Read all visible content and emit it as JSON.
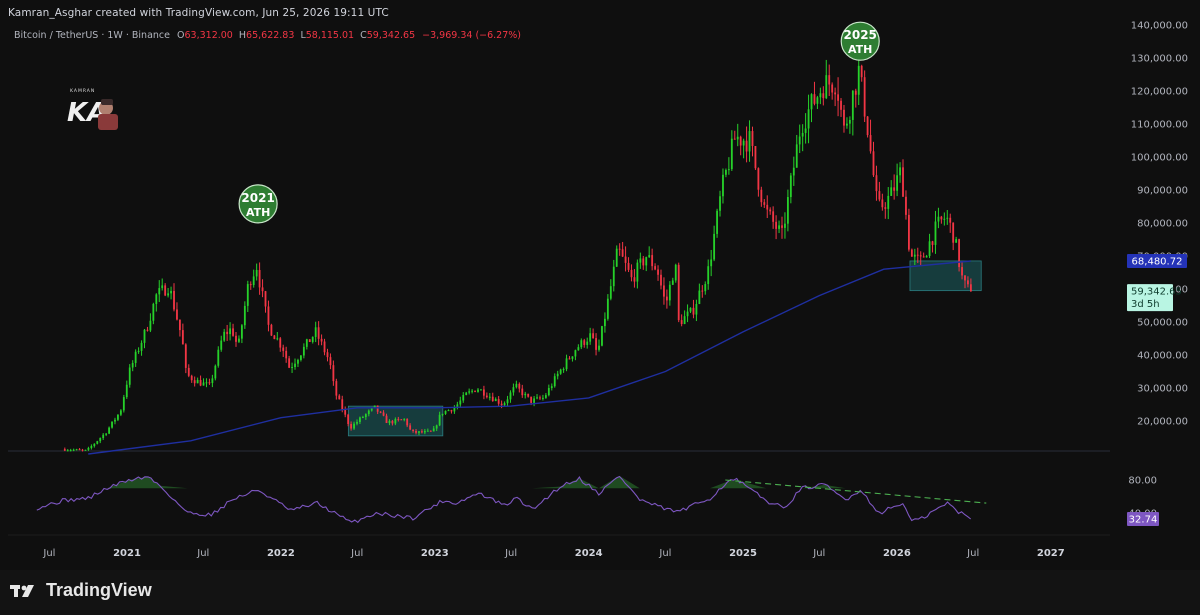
{
  "header": {
    "credit": "Kamran_Asghar created with TradingView.com, Jun 25, 2026 19:11 UTC"
  },
  "legend": {
    "symbol": "Bitcoin / TetherUS · 1W · Binance",
    "open_label": "O",
    "open": "63,312.00",
    "high_label": "H",
    "high": "65,622.83",
    "low_label": "L",
    "low": "58,115.01",
    "close_label": "C",
    "close": "59,342.65",
    "change": "−3,969.34 (−6.27%)"
  },
  "logo": {
    "text": "KA",
    "subtext": "KAMRAN",
    "icon": "kamran-asghar-avatar-logo"
  },
  "annotations": [
    {
      "year": "2021",
      "text": "ATH"
    },
    {
      "year": "2025",
      "text": "ATH"
    }
  ],
  "price_labels": {
    "ma_value": "68,480.72",
    "last_price": "59,342.65",
    "countdown": "3d 5h"
  },
  "rsi_label": "32.74",
  "footer": {
    "brand": "TradingView",
    "icon": "tradingview-logo-icon"
  },
  "colors": {
    "up": "#26d12a",
    "down": "#f23645",
    "ma": "#1f2fa0",
    "rsi": "#7e57c2",
    "box": "#1a5a5c",
    "ath_circle": "#2e7d32",
    "trendline": "#4caf50",
    "bg": "#0f0f0f"
  },
  "chart_data": [
    {
      "type": "candlestick",
      "title": "Bitcoin / TetherUS · 1W · Binance",
      "y_axis_ticks": [
        "140,000.00",
        "130,000.00",
        "120,000.00",
        "110,000.00",
        "100,000.00",
        "90,000.00",
        "80,000.00",
        "70,000.00",
        "60,000.00",
        "50,000.00",
        "40,000.00",
        "30,000.00",
        "20,000.00"
      ],
      "ylim": [
        10000,
        142000
      ],
      "x_axis_ticks": [
        "Jul",
        "2021",
        "Jul",
        "2022",
        "Jul",
        "2023",
        "Jul",
        "2024",
        "Jul",
        "2025",
        "Jul",
        "2026",
        "Jul",
        "2027"
      ],
      "price_path": [
        [
          "2020-08-01",
          11500
        ],
        [
          "2020-10-01",
          11000
        ],
        [
          "2020-11-15",
          16500
        ],
        [
          "2020-12-20",
          23000
        ],
        [
          "2021-01-10",
          35000
        ],
        [
          "2021-02-20",
          48000
        ],
        [
          "2021-03-15",
          58000
        ],
        [
          "2021-04-14",
          61000
        ],
        [
          "2021-05-15",
          45000
        ],
        [
          "2021-05-25",
          34000
        ],
        [
          "2021-06-20",
          32000
        ],
        [
          "2021-07-20",
          30500
        ],
        [
          "2021-08-20",
          46000
        ],
        [
          "2021-09-10",
          48000
        ],
        [
          "2021-09-25",
          42000
        ],
        [
          "2021-10-20",
          62000
        ],
        [
          "2021-11-08",
          67000
        ],
        [
          "2021-12-05",
          49000
        ],
        [
          "2022-01-10",
          42000
        ],
        [
          "2022-01-25",
          36000
        ],
        [
          "2022-03-28",
          47000
        ],
        [
          "2022-04-30",
          38000
        ],
        [
          "2022-05-12",
          29000
        ],
        [
          "2022-06-18",
          18000
        ],
        [
          "2022-07-15",
          21000
        ],
        [
          "2022-08-15",
          24000
        ],
        [
          "2022-09-15",
          19500
        ],
        [
          "2022-10-25",
          20500
        ],
        [
          "2022-11-10",
          16500
        ],
        [
          "2022-12-31",
          16600
        ],
        [
          "2023-01-20",
          22500
        ],
        [
          "2023-02-20",
          24000
        ],
        [
          "2023-03-20",
          28000
        ],
        [
          "2023-04-15",
          30000
        ],
        [
          "2023-06-15",
          25000
        ],
        [
          "2023-07-15",
          30500
        ],
        [
          "2023-08-20",
          26000
        ],
        [
          "2023-09-20",
          27000
        ],
        [
          "2023-10-25",
          34500
        ],
        [
          "2023-12-05",
          42000
        ],
        [
          "2024-01-10",
          46000
        ],
        [
          "2024-01-25",
          40000
        ],
        [
          "2024-02-28",
          62000
        ],
        [
          "2024-03-14",
          72000
        ],
        [
          "2024-04-15",
          63000
        ],
        [
          "2024-05-20",
          70000
        ],
        [
          "2024-06-15",
          66000
        ],
        [
          "2024-07-05",
          55000
        ],
        [
          "2024-07-28",
          68000
        ],
        [
          "2024-08-05",
          50000
        ],
        [
          "2024-09-06",
          53000
        ],
        [
          "2024-10-15",
          66000
        ],
        [
          "2024-11-15",
          90000
        ],
        [
          "2024-12-17",
          106000
        ],
        [
          "2025-01-20",
          105000
        ],
        [
          "2025-02-25",
          84000
        ],
        [
          "2025-04-07",
          76000
        ],
        [
          "2025-05-22",
          110000
        ],
        [
          "2025-07-14",
          122000
        ],
        [
          "2025-08-14",
          123000
        ],
        [
          "2025-09-01",
          108000
        ],
        [
          "2025-10-06",
          126000
        ],
        [
          "2025-10-25",
          111000
        ],
        [
          "2025-11-20",
          84000
        ],
        [
          "2025-12-20",
          88000
        ],
        [
          "2026-01-15",
          96000
        ],
        [
          "2026-02-05",
          70000
        ],
        [
          "2026-03-01",
          68000
        ],
        [
          "2026-04-10",
          79000
        ],
        [
          "2026-05-01",
          82000
        ],
        [
          "2026-05-20",
          76000
        ],
        [
          "2026-06-10",
          62000
        ],
        [
          "2026-06-25",
          59342.65
        ]
      ],
      "moving_average": [
        [
          "2020-10-01",
          10000
        ],
        [
          "2021-06-01",
          14000
        ],
        [
          "2022-01-01",
          21000
        ],
        [
          "2022-07-01",
          24000
        ],
        [
          "2023-01-01",
          24000
        ],
        [
          "2023-07-01",
          24500
        ],
        [
          "2024-01-01",
          27000
        ],
        [
          "2024-07-01",
          35000
        ],
        [
          "2025-01-01",
          47000
        ],
        [
          "2025-07-01",
          58000
        ],
        [
          "2025-12-01",
          66000
        ],
        [
          "2026-06-25",
          68480.72
        ]
      ],
      "highlight_zones": [
        {
          "x": [
            "2022-06-10",
            "2023-01-20"
          ],
          "y": [
            15500,
            24500
          ]
        },
        {
          "x": [
            "2026-02-01",
            "2026-07-20"
          ],
          "y": [
            59500,
            68500
          ]
        }
      ]
    },
    {
      "type": "line",
      "title": "RSI",
      "y_axis_ticks": [
        "80.00",
        "40.00"
      ],
      "ylim": [
        20,
        100
      ],
      "rsi_path": [
        [
          "2020-06-01",
          46
        ],
        [
          "2020-08-01",
          55
        ],
        [
          "2020-10-01",
          58
        ],
        [
          "2020-11-15",
          70
        ],
        [
          "2021-01-05",
          80
        ],
        [
          "2021-02-20",
          84
        ],
        [
          "2021-03-20",
          73
        ],
        [
          "2021-05-25",
          40
        ],
        [
          "2021-07-20",
          38
        ],
        [
          "2021-09-10",
          57
        ],
        [
          "2021-11-08",
          68
        ],
        [
          "2022-01-25",
          43
        ],
        [
          "2022-03-28",
          52
        ],
        [
          "2022-06-18",
          28
        ],
        [
          "2022-08-15",
          40
        ],
        [
          "2022-11-10",
          34
        ],
        [
          "2023-01-20",
          55
        ],
        [
          "2023-02-20",
          52
        ],
        [
          "2023-04-15",
          64
        ],
        [
          "2023-06-15",
          49
        ],
        [
          "2023-07-15",
          58
        ],
        [
          "2023-08-20",
          44
        ],
        [
          "2023-10-25",
          72
        ],
        [
          "2023-12-10",
          82
        ],
        [
          "2024-01-25",
          64
        ],
        [
          "2024-03-14",
          85
        ],
        [
          "2024-05-01",
          56
        ],
        [
          "2024-07-05",
          44
        ],
        [
          "2024-08-05",
          42
        ],
        [
          "2024-10-15",
          58
        ],
        [
          "2024-11-25",
          78
        ],
        [
          "2024-12-17",
          80
        ],
        [
          "2025-02-25",
          55
        ],
        [
          "2025-04-07",
          46
        ],
        [
          "2025-05-22",
          70
        ],
        [
          "2025-07-14",
          74
        ],
        [
          "2025-09-01",
          56
        ],
        [
          "2025-10-06",
          68
        ],
        [
          "2025-11-20",
          40
        ],
        [
          "2026-01-15",
          52
        ],
        [
          "2026-02-05",
          30
        ],
        [
          "2026-03-01",
          33
        ],
        [
          "2026-04-10",
          46
        ],
        [
          "2026-05-01",
          52
        ],
        [
          "2026-05-20",
          44
        ],
        [
          "2026-06-25",
          32.74
        ]
      ],
      "trendline": [
        [
          "2024-11-20",
          80
        ],
        [
          "2026-08-01",
          52
        ]
      ]
    }
  ]
}
